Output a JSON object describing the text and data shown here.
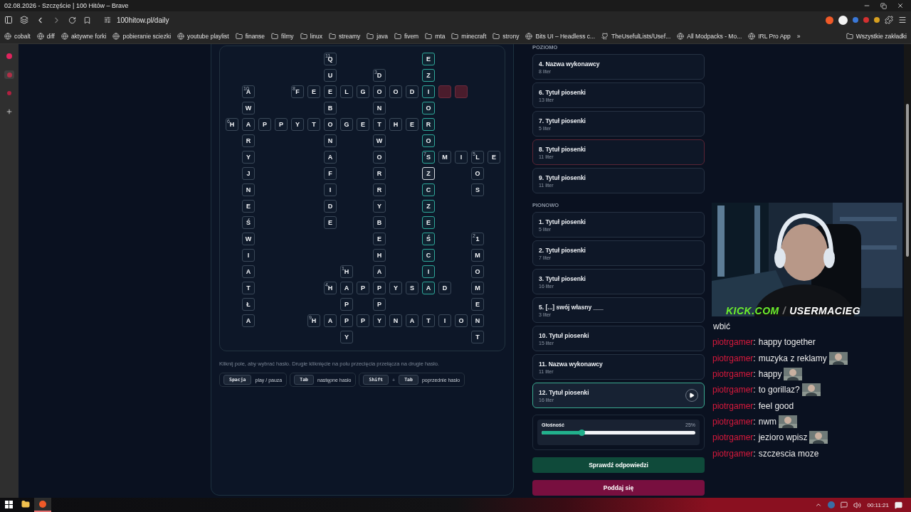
{
  "browser": {
    "title": "02.08.2026 - Szczęście | 100 Hitów – Brave",
    "url": "100hitow.pl/daily",
    "bookmarks": [
      {
        "label": "cobalt",
        "kind": "site"
      },
      {
        "label": "diff",
        "kind": "site"
      },
      {
        "label": "aktywne forki",
        "kind": "site"
      },
      {
        "label": "pobieranie sciezki",
        "kind": "site"
      },
      {
        "label": "youtube playlist",
        "kind": "site"
      },
      {
        "label": "finanse",
        "kind": "folder"
      },
      {
        "label": "filmy",
        "kind": "folder"
      },
      {
        "label": "linux",
        "kind": "folder"
      },
      {
        "label": "streamy",
        "kind": "folder"
      },
      {
        "label": "java",
        "kind": "folder"
      },
      {
        "label": "fivem",
        "kind": "folder"
      },
      {
        "label": "mta",
        "kind": "folder"
      },
      {
        "label": "minecraft",
        "kind": "folder"
      },
      {
        "label": "strony",
        "kind": "folder"
      },
      {
        "label": "Bits UI – Headless c...",
        "kind": "site"
      },
      {
        "label": "TheUsefulLists/Usef...",
        "kind": "github"
      },
      {
        "label": "All Modpacks - Mo...",
        "kind": "site"
      },
      {
        "label": "IRL Pro App",
        "kind": "site"
      }
    ],
    "bookmarks_more": "»",
    "all_bookmarks": "Wszystkie zakładki"
  },
  "crossword": {
    "rows": [
      {
        "cells": [
          "",
          "",
          "",
          "",
          "",
          "",
          {
            "letter": "Q",
            "number": "11",
            "selected": false,
            "highlighted": false,
            "missing": false
          },
          "",
          "",
          "",
          "",
          "",
          {
            "letter": "E",
            "selected": false,
            "highlighted": true,
            "missing": false
          }
        ]
      },
      {
        "cells": [
          "",
          "",
          "",
          "",
          "",
          "",
          {
            "letter": "U",
            "selected": false,
            "highlighted": false,
            "missing": false
          },
          "",
          "",
          {
            "letter": "D",
            "number": "3",
            "selected": false,
            "highlighted": false,
            "missing": false
          },
          "",
          "",
          {
            "letter": "Z",
            "selected": false,
            "highlighted": true,
            "missing": false
          }
        ]
      },
      {
        "cells": [
          "",
          {
            "letter": "A",
            "number": "10",
            "selected": false,
            "highlighted": false,
            "missing": false
          },
          "",
          "",
          {
            "letter": "F",
            "number": "8",
            "selected": false,
            "highlighted": false,
            "missing": false
          },
          {
            "letter": "E",
            "selected": false,
            "highlighted": false,
            "missing": false
          },
          {
            "letter": "E",
            "selected": false,
            "highlighted": false,
            "missing": false
          },
          {
            "letter": "L",
            "selected": false,
            "highlighted": false,
            "missing": false
          },
          {
            "letter": "G",
            "selected": false,
            "highlighted": false,
            "missing": false
          },
          {
            "letter": "O",
            "selected": false,
            "highlighted": false,
            "missing": false
          },
          {
            "letter": "O",
            "selected": false,
            "highlighted": false,
            "missing": false
          },
          {
            "letter": "D",
            "selected": false,
            "highlighted": false,
            "missing": false
          },
          {
            "letter": "I",
            "selected": false,
            "highlighted": true,
            "missing": false
          },
          {
            "selected": false,
            "highlighted": false,
            "missing": true
          },
          {
            "selected": false,
            "highlighted": false,
            "missing": true
          }
        ]
      },
      {
        "cells": [
          "",
          {
            "letter": "W",
            "selected": false,
            "highlighted": false,
            "missing": false
          },
          "",
          "",
          "",
          "",
          {
            "letter": "B",
            "selected": false,
            "highlighted": false,
            "missing": false
          },
          "",
          "",
          {
            "letter": "N",
            "selected": false,
            "highlighted": false,
            "missing": false
          },
          "",
          "",
          {
            "letter": "O",
            "selected": false,
            "highlighted": true,
            "missing": false
          }
        ]
      },
      {
        "cells": [
          {
            "letter": "H",
            "number": "6",
            "selected": false,
            "highlighted": false,
            "missing": false
          },
          {
            "letter": "A",
            "selected": false,
            "highlighted": false,
            "missing": false
          },
          {
            "letter": "P",
            "selected": false,
            "highlighted": false,
            "missing": false
          },
          {
            "letter": "P",
            "selected": false,
            "highlighted": false,
            "missing": false
          },
          {
            "letter": "Y",
            "selected": false,
            "highlighted": false,
            "missing": false
          },
          {
            "letter": "T",
            "selected": false,
            "highlighted": false,
            "missing": false
          },
          {
            "letter": "O",
            "selected": false,
            "highlighted": false,
            "missing": false
          },
          {
            "letter": "G",
            "selected": false,
            "highlighted": false,
            "missing": false
          },
          {
            "letter": "E",
            "selected": false,
            "highlighted": false,
            "missing": false
          },
          {
            "letter": "T",
            "selected": false,
            "highlighted": false,
            "missing": false
          },
          {
            "letter": "H",
            "selected": false,
            "highlighted": false,
            "missing": false
          },
          {
            "letter": "E",
            "selected": false,
            "highlighted": false,
            "missing": false
          },
          {
            "letter": "R",
            "selected": false,
            "highlighted": true,
            "missing": false
          }
        ]
      },
      {
        "cells": [
          "",
          {
            "letter": "R",
            "selected": false,
            "highlighted": false,
            "missing": false
          },
          "",
          "",
          "",
          "",
          {
            "letter": "N",
            "selected": false,
            "highlighted": false,
            "missing": false
          },
          "",
          "",
          {
            "letter": "W",
            "selected": false,
            "highlighted": false,
            "missing": false
          },
          "",
          "",
          {
            "letter": "O",
            "selected": false,
            "highlighted": true,
            "missing": false
          }
        ]
      },
      {
        "cells": [
          "",
          {
            "letter": "Y",
            "selected": false,
            "highlighted": false,
            "missing": false
          },
          "",
          "",
          "",
          "",
          {
            "letter": "A",
            "selected": false,
            "highlighted": false,
            "missing": false
          },
          "",
          "",
          {
            "letter": "O",
            "selected": false,
            "highlighted": false,
            "missing": false
          },
          "",
          "",
          {
            "letter": "S",
            "number": "7",
            "selected": false,
            "highlighted": true,
            "missing": false
          },
          {
            "letter": "M",
            "selected": false,
            "highlighted": false,
            "missing": false
          },
          {
            "letter": "I",
            "selected": false,
            "highlighted": false,
            "missing": false
          },
          {
            "letter": "L",
            "number": "5",
            "selected": false,
            "highlighted": false,
            "missing": false
          },
          {
            "letter": "E",
            "selected": false,
            "highlighted": false,
            "missing": false
          }
        ]
      },
      {
        "cells": [
          "",
          {
            "letter": "J",
            "selected": false,
            "highlighted": false,
            "missing": false
          },
          "",
          "",
          "",
          "",
          {
            "letter": "F",
            "selected": false,
            "highlighted": false,
            "missing": false
          },
          "",
          "",
          {
            "letter": "R",
            "selected": false,
            "highlighted": false,
            "missing": false
          },
          "",
          "",
          {
            "letter": "Z",
            "selected": true,
            "highlighted": true,
            "missing": false
          },
          "",
          "",
          {
            "letter": "O",
            "selected": false,
            "highlighted": false,
            "missing": false
          }
        ]
      },
      {
        "cells": [
          "",
          {
            "letter": "N",
            "selected": false,
            "highlighted": false,
            "missing": false
          },
          "",
          "",
          "",
          "",
          {
            "letter": "I",
            "selected": false,
            "highlighted": false,
            "missing": false
          },
          "",
          "",
          {
            "letter": "R",
            "selected": false,
            "highlighted": false,
            "missing": false
          },
          "",
          "",
          {
            "letter": "C",
            "selected": false,
            "highlighted": true,
            "missing": false
          },
          "",
          "",
          {
            "letter": "S",
            "selected": false,
            "highlighted": false,
            "missing": false
          }
        ]
      },
      {
        "cells": [
          "",
          {
            "letter": "E",
            "selected": false,
            "highlighted": false,
            "missing": false
          },
          "",
          "",
          "",
          "",
          {
            "letter": "D",
            "selected": false,
            "highlighted": false,
            "missing": false
          },
          "",
          "",
          {
            "letter": "Y",
            "selected": false,
            "highlighted": false,
            "missing": false
          },
          "",
          "",
          {
            "letter": "Z",
            "selected": false,
            "highlighted": true,
            "missing": false
          }
        ]
      },
      {
        "cells": [
          "",
          {
            "letter": "Ś",
            "selected": false,
            "highlighted": false,
            "missing": false
          },
          "",
          "",
          "",
          "",
          {
            "letter": "E",
            "selected": false,
            "highlighted": false,
            "missing": false
          },
          "",
          "",
          {
            "letter": "B",
            "selected": false,
            "highlighted": false,
            "missing": false
          },
          "",
          "",
          {
            "letter": "E",
            "selected": false,
            "highlighted": true,
            "missing": false
          }
        ]
      },
      {
        "cells": [
          "",
          {
            "letter": "W",
            "selected": false,
            "highlighted": false,
            "missing": false
          },
          "",
          "",
          "",
          "",
          "",
          "",
          "",
          {
            "letter": "E",
            "selected": false,
            "highlighted": false,
            "missing": false
          },
          "",
          "",
          {
            "letter": "Ś",
            "selected": false,
            "highlighted": true,
            "missing": false
          },
          "",
          "",
          {
            "letter": "1",
            "number": "2",
            "selected": false,
            "highlighted": false,
            "missing": false
          }
        ]
      },
      {
        "cells": [
          "",
          {
            "letter": "I",
            "selected": false,
            "highlighted": false,
            "missing": false
          },
          "",
          "",
          "",
          "",
          "",
          "",
          "",
          {
            "letter": "H",
            "selected": false,
            "highlighted": false,
            "missing": false
          },
          "",
          "",
          {
            "letter": "C",
            "selected": false,
            "highlighted": true,
            "missing": false
          },
          "",
          "",
          {
            "letter": "M",
            "selected": false,
            "highlighted": false,
            "missing": false
          }
        ]
      },
      {
        "cells": [
          "",
          {
            "letter": "A",
            "selected": false,
            "highlighted": false,
            "missing": false
          },
          "",
          "",
          "",
          "",
          "",
          {
            "letter": "H",
            "number": "1",
            "selected": false,
            "highlighted": false,
            "missing": false
          },
          "",
          {
            "letter": "A",
            "selected": false,
            "highlighted": false,
            "missing": false
          },
          "",
          "",
          {
            "letter": "I",
            "selected": false,
            "highlighted": true,
            "missing": false
          },
          "",
          "",
          {
            "letter": "O",
            "selected": false,
            "highlighted": false,
            "missing": false
          }
        ]
      },
      {
        "cells": [
          "",
          {
            "letter": "T",
            "selected": false,
            "highlighted": false,
            "missing": false
          },
          "",
          "",
          "",
          "",
          {
            "letter": "H",
            "number": "4",
            "selected": false,
            "highlighted": false,
            "missing": false
          },
          {
            "letter": "A",
            "selected": false,
            "highlighted": false,
            "missing": false
          },
          {
            "letter": "P",
            "selected": false,
            "highlighted": false,
            "missing": false
          },
          {
            "letter": "P",
            "selected": false,
            "highlighted": false,
            "missing": false
          },
          {
            "letter": "Y",
            "selected": false,
            "highlighted": false,
            "missing": false
          },
          {
            "letter": "S",
            "selected": false,
            "highlighted": false,
            "missing": false
          },
          {
            "letter": "A",
            "selected": false,
            "highlighted": true,
            "missing": false
          },
          {
            "letter": "D",
            "selected": false,
            "highlighted": false,
            "missing": false
          },
          "",
          {
            "letter": "M",
            "selected": false,
            "highlighted": false,
            "missing": false
          }
        ]
      },
      {
        "cells": [
          "",
          {
            "letter": "Ł",
            "selected": false,
            "highlighted": false,
            "missing": false
          },
          "",
          "",
          "",
          "",
          "",
          {
            "letter": "P",
            "selected": false,
            "highlighted": false,
            "missing": false
          },
          "",
          {
            "letter": "P",
            "selected": false,
            "highlighted": false,
            "missing": false
          },
          "",
          "",
          "",
          "",
          "",
          {
            "letter": "E",
            "selected": false,
            "highlighted": false,
            "missing": false
          }
        ]
      },
      {
        "cells": [
          "",
          {
            "letter": "A",
            "selected": false,
            "highlighted": false,
            "missing": false
          },
          "",
          "",
          "",
          {
            "letter": "H",
            "number": "9",
            "selected": false,
            "highlighted": false,
            "missing": false
          },
          {
            "letter": "A",
            "selected": false,
            "highlighted": false,
            "missing": false
          },
          {
            "letter": "P",
            "selected": false,
            "highlighted": false,
            "missing": false
          },
          {
            "letter": "P",
            "selected": false,
            "highlighted": false,
            "missing": false
          },
          {
            "letter": "Y",
            "selected": false,
            "highlighted": false,
            "missing": false
          },
          {
            "letter": "N",
            "selected": false,
            "highlighted": false,
            "missing": false
          },
          {
            "letter": "A",
            "selected": false,
            "highlighted": false,
            "missing": false
          },
          {
            "letter": "T",
            "selected": false,
            "highlighted": false,
            "missing": false
          },
          {
            "letter": "I",
            "selected": false,
            "highlighted": false,
            "missing": false
          },
          {
            "letter": "O",
            "selected": false,
            "highlighted": false,
            "missing": false
          },
          {
            "letter": "N",
            "selected": false,
            "highlighted": false,
            "missing": false
          }
        ]
      },
      {
        "cells": [
          "",
          "",
          "",
          "",
          "",
          "",
          "",
          {
            "letter": "Y",
            "selected": false,
            "highlighted": false,
            "missing": false
          },
          "",
          "",
          "",
          "",
          "",
          "",
          "",
          {
            "letter": "T",
            "selected": false,
            "highlighted": false,
            "missing": false
          }
        ]
      }
    ],
    "help": "Kliknij pole, aby wybrać hasło. Drugie kliknięcie na polu przecięcia przełącza na drugie hasło.",
    "shortcuts": [
      {
        "keys": [
          "Spacja"
        ],
        "label": "play / pauza"
      },
      {
        "keys": [
          "Tab"
        ],
        "label": "następne hasło"
      },
      {
        "keys": [
          "Shift",
          "Tab"
        ],
        "joiner": "+",
        "label": "poprzednie hasło"
      }
    ]
  },
  "clues": [
    {
      "title": "POZIOMO",
      "items": [
        {
          "title": "4. Nazwa wykonawcy",
          "length": "8 liter",
          "selected": false,
          "wrong": false
        },
        {
          "title": "6. Tytuł piosenki",
          "length": "13 liter",
          "selected": false,
          "wrong": false
        },
        {
          "title": "7. Tytuł piosenki",
          "length": "5 liter",
          "selected": false,
          "wrong": false
        },
        {
          "title": "8. Tytuł piosenki",
          "length": "11 liter",
          "selected": false,
          "wrong": true
        },
        {
          "title": "9. Tytuł piosenki",
          "length": "11 liter",
          "selected": false,
          "wrong": false
        }
      ]
    },
    {
      "title": "PIONOWO",
      "items": [
        {
          "title": "1. Tytuł piosenki",
          "length": "5 liter",
          "selected": false,
          "wrong": false
        },
        {
          "title": "2. Tytuł piosenki",
          "length": "7 liter",
          "selected": false,
          "wrong": false
        },
        {
          "title": "3. Tytuł piosenki",
          "length": "16 liter",
          "selected": false,
          "wrong": false
        },
        {
          "title": "5. [...] swój własny ___",
          "length": "3 liter",
          "selected": false,
          "wrong": false
        },
        {
          "title": "10. Tytuł piosenki",
          "length": "15 liter",
          "selected": false,
          "wrong": false
        },
        {
          "title": "11. Nazwa wykonawcy",
          "length": "11 liter",
          "selected": false,
          "wrong": false
        },
        {
          "title": "12. Tytuł piosenki",
          "length": "16 liter",
          "selected": true,
          "wrong": false
        }
      ]
    }
  ],
  "volume": {
    "label": "Głośność",
    "reading": "25%",
    "level": 0.26
  },
  "buttons": [
    {
      "label": "Sprawdź odpowiedzi",
      "kind": "check"
    },
    {
      "label": "Poddaj się",
      "kind": "give-up"
    }
  ],
  "stream": {
    "overlay": {
      "brand": "KICK.COM",
      "separator": "/",
      "handle": "USERMACIEG"
    },
    "chat": [
      {
        "text": "wbić",
        "emote": false
      },
      {
        "user": "piotrgamer",
        "colon": ":",
        "text": "happy together",
        "emote": false
      },
      {
        "user": "piotrgamer",
        "colon": ":",
        "text": "muzyka z reklamy",
        "emote": true
      },
      {
        "user": "piotrgamer",
        "colon": ":",
        "text": "happy",
        "emote": true
      },
      {
        "user": "piotrgamer",
        "colon": ":",
        "text": "to gorillaz?",
        "emote": true
      },
      {
        "user": "piotrgamer",
        "colon": ":",
        "text": "feel good",
        "emote": false
      },
      {
        "user": "piotrgamer",
        "colon": ":",
        "text": "nwm",
        "emote": true
      },
      {
        "user": "piotrgamer",
        "colon": ":",
        "text": "jezioro wpisz",
        "emote": true
      },
      {
        "user": "piotrgamer",
        "colon": ":",
        "text": "szczescia moze",
        "emote": false
      }
    ]
  },
  "taskbar": {
    "clock": "00:11:21"
  }
}
